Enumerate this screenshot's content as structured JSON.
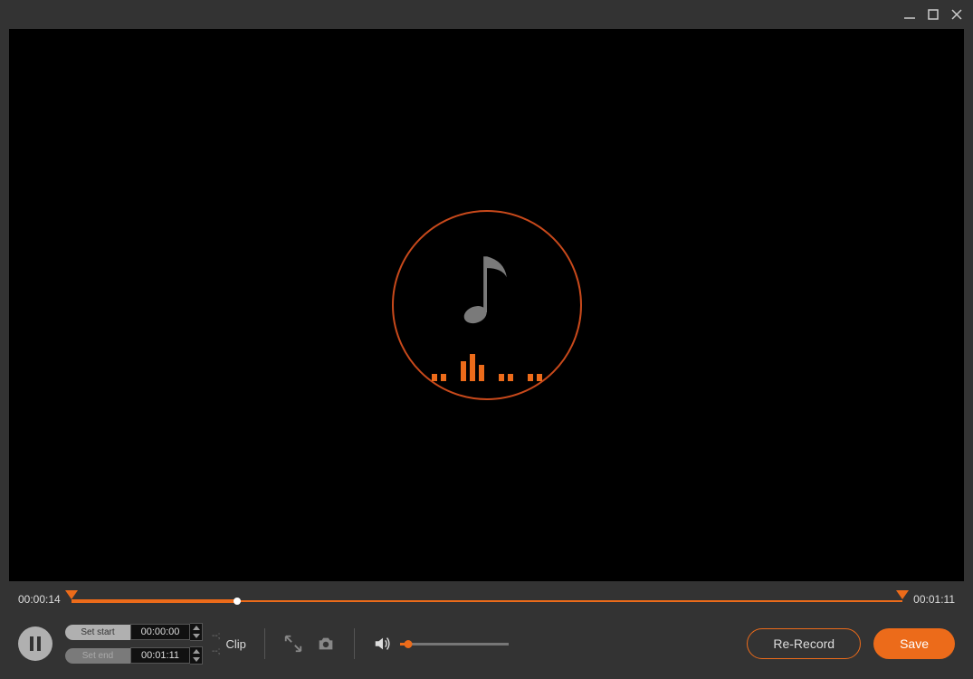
{
  "titlebar": {},
  "playback": {
    "current": "00:00:14",
    "total": "00:01:11",
    "progress_pct": 20,
    "start_marker_pct": 0,
    "end_marker_pct": 100
  },
  "clip": {
    "set_start_label": "Set start",
    "set_end_label": "Set end",
    "start_time": "00:00:00",
    "end_time": "00:01:11",
    "label": "Clip"
  },
  "volume": {
    "level_pct": 8
  },
  "actions": {
    "rerecord_label": "Re-Record",
    "save_label": "Save"
  }
}
